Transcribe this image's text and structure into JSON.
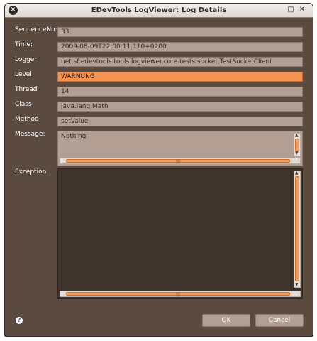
{
  "window": {
    "title": "EDevTools LogViewer: Log Details"
  },
  "fields": {
    "sequence_label": "SequenceNo:",
    "sequence_value": "33",
    "time_label": "Time:",
    "time_value": "2009-08-09T22:00:11.110+0200",
    "logger_label": "Logger",
    "logger_value": "net.sf.edevtools.tools.logviewer.core.tests.socket.TestSocketClient",
    "level_label": "Level",
    "level_value": "WARNUNG",
    "thread_label": "Thread",
    "thread_value": "14",
    "class_label": "Class",
    "class_value": "java.lang.Math",
    "method_label": "Method",
    "method_value": "setValue",
    "message_label": "Message:",
    "message_value": "Nothing",
    "exception_label": "Exception"
  },
  "buttons": {
    "ok": "OK",
    "cancel": "Cancel",
    "help": "?"
  },
  "colors": {
    "level_highlight": "#f49450",
    "background": "#5a4a40",
    "field": "#b29e92"
  }
}
